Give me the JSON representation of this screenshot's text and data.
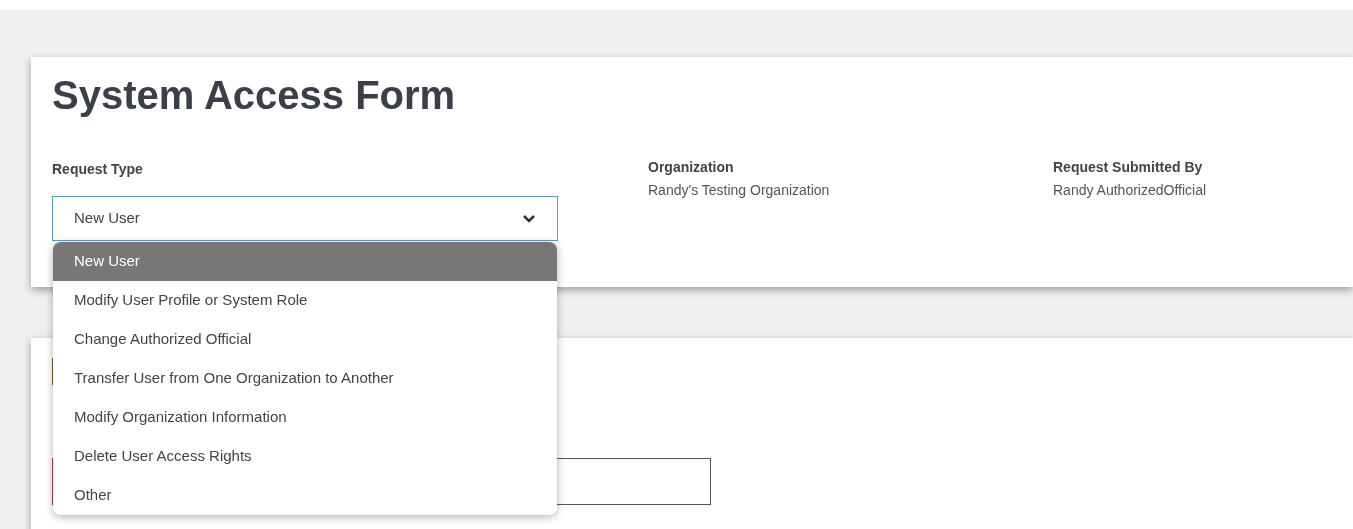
{
  "form": {
    "title": "System Access Form",
    "request_type": {
      "label": "Request Type",
      "value": "New User",
      "expanded": true,
      "options": [
        {
          "label": "New User",
          "selected": true
        },
        {
          "label": "Modify User Profile or System Role",
          "selected": false
        },
        {
          "label": "Change Authorized Official",
          "selected": false
        },
        {
          "label": "Transfer User from One Organization to Another",
          "selected": false
        },
        {
          "label": "Modify Organization Information",
          "selected": false
        },
        {
          "label": "Delete User Access Rights",
          "selected": false
        },
        {
          "label": "Other",
          "selected": false
        }
      ]
    },
    "details": [
      {
        "label": "Organization",
        "value": "Randy's Testing Organization"
      },
      {
        "label": "Request Submitted By",
        "value": "Randy AuthorizedOfficial"
      }
    ]
  }
}
